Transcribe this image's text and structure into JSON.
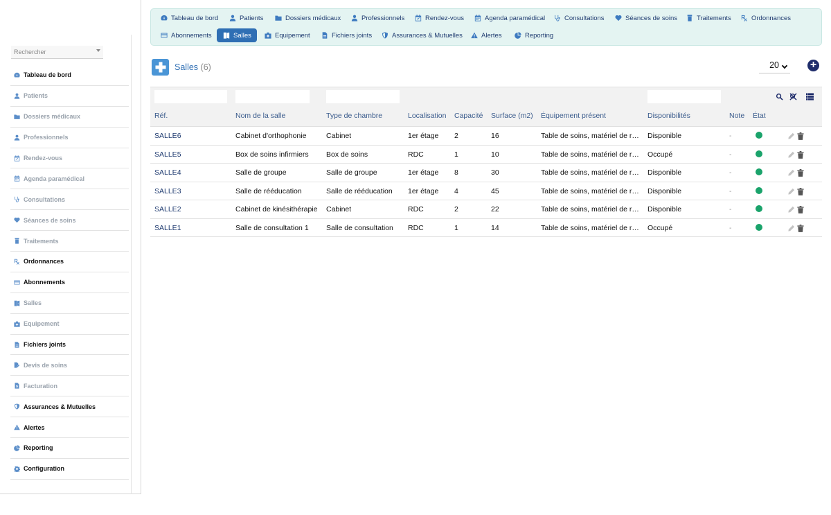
{
  "sidebar": {
    "search_placeholder": "Rechercher",
    "items": [
      {
        "label": "Tableau de bord",
        "icon": "dashboard-icon",
        "dark": true
      },
      {
        "label": "Patients",
        "icon": "user-icon",
        "dark": false
      },
      {
        "label": "Dossiers médicaux",
        "icon": "folder-icon",
        "dark": false
      },
      {
        "label": "Professionnels",
        "icon": "user-icon",
        "dark": false
      },
      {
        "label": "Rendez-vous",
        "icon": "calendar-check-icon",
        "dark": false
      },
      {
        "label": "Agenda paramédical",
        "icon": "calendar-icon",
        "dark": false
      },
      {
        "label": "Consultations",
        "icon": "stethoscope-icon",
        "dark": false
      },
      {
        "label": "Séances de soins",
        "icon": "heart-icon",
        "dark": false
      },
      {
        "label": "Traitements",
        "icon": "prescription-bottle-icon",
        "dark": false
      },
      {
        "label": "Ordonnances",
        "icon": "prescription-icon",
        "dark": true
      },
      {
        "label": "Abonnements",
        "icon": "card-icon",
        "dark": true
      },
      {
        "label": "Salles",
        "icon": "door-icon",
        "dark": false
      },
      {
        "label": "Equipement",
        "icon": "medkit-icon",
        "dark": false
      },
      {
        "label": "Fichiers joints",
        "icon": "file-icon",
        "dark": true
      },
      {
        "label": "Devis de soins",
        "icon": "file-edit-icon",
        "dark": false
      },
      {
        "label": "Facturation",
        "icon": "invoice-icon",
        "dark": false
      },
      {
        "label": "Assurances & Mutuelles",
        "icon": "shield-icon",
        "dark": true
      },
      {
        "label": "Alertes",
        "icon": "warning-icon",
        "dark": true
      },
      {
        "label": "Reporting",
        "icon": "chart-pie-icon",
        "dark": true
      },
      {
        "label": "Configuration",
        "icon": "gear-icon",
        "dark": true
      }
    ]
  },
  "topnav": {
    "row1": [
      {
        "label": "Tableau de bord",
        "icon": "dashboard-icon"
      },
      {
        "label": "Patients",
        "icon": "user-icon"
      },
      {
        "label": "Dossiers médicaux",
        "icon": "folder-icon"
      },
      {
        "label": "Professionnels",
        "icon": "user-icon"
      },
      {
        "label": "Rendez-vous",
        "icon": "calendar-check-icon"
      },
      {
        "label": "Agenda paramédical",
        "icon": "calendar-icon"
      },
      {
        "label": "Consultations",
        "icon": "stethoscope-icon"
      },
      {
        "label": "Séances de soins",
        "icon": "heart-icon"
      },
      {
        "label": "Traitements",
        "icon": "prescription-bottle-icon"
      },
      {
        "label": "Ordonnances",
        "icon": "prescription-icon"
      }
    ],
    "row2": [
      {
        "label": "Abonnements",
        "icon": "card-icon"
      },
      {
        "label": "Salles",
        "icon": "door-icon",
        "active": true
      },
      {
        "label": "Equipement",
        "icon": "medkit-icon"
      },
      {
        "label": "Fichiers joints",
        "icon": "file-icon"
      },
      {
        "label": "Assurances & Mutuelles",
        "icon": "shield-icon"
      },
      {
        "label": "Alertes",
        "icon": "warning-icon"
      },
      {
        "label": "Reporting",
        "icon": "chart-pie-icon"
      }
    ]
  },
  "page": {
    "title": "Salles",
    "count": "(6)",
    "per_page": "20"
  },
  "table": {
    "columns": [
      "Réf.",
      "Nom de la salle",
      "Type de chambre",
      "Localisation",
      "Capacité",
      "Surface (m2)",
      "Équipement présent",
      "Disponibilités",
      "Note",
      "État"
    ],
    "rows": [
      {
        "ref": "SALLE6",
        "nom": "Cabinet d'orthophonie",
        "type": "Cabinet",
        "loc": "1er étage",
        "cap": "2",
        "surf": "16",
        "equip": "Table de soins, matériel de rééducation",
        "dispo": "Disponible",
        "note": "-"
      },
      {
        "ref": "SALLE5",
        "nom": "Box de soins infirmiers",
        "type": "Box de soins",
        "loc": "RDC",
        "cap": "1",
        "surf": "10",
        "equip": "Table de soins, matériel de rééducation",
        "dispo": "Occupé",
        "note": "-"
      },
      {
        "ref": "SALLE4",
        "nom": "Salle de groupe",
        "type": "Salle de groupe",
        "loc": "1er étage",
        "cap": "8",
        "surf": "30",
        "equip": "Table de soins, matériel de rééducation",
        "dispo": "Disponible",
        "note": "-"
      },
      {
        "ref": "SALLE3",
        "nom": "Salle de rééducation",
        "type": "Salle de rééducation",
        "loc": "1er étage",
        "cap": "4",
        "surf": "45",
        "equip": "Table de soins, matériel de rééducation",
        "dispo": "Disponible",
        "note": "-"
      },
      {
        "ref": "SALLE2",
        "nom": "Cabinet de kinésithérapie",
        "type": "Cabinet",
        "loc": "RDC",
        "cap": "2",
        "surf": "22",
        "equip": "Table de soins, matériel de rééducation",
        "dispo": "Disponible",
        "note": "-"
      },
      {
        "ref": "SALLE1",
        "nom": "Salle de consultation 1",
        "type": "Salle de consultation",
        "loc": "RDC",
        "cap": "1",
        "surf": "14",
        "equip": "Table de soins, matériel de rééducation",
        "dispo": "Occupé",
        "note": "-"
      }
    ]
  },
  "colors": {
    "accent": "#2f6fb4",
    "nav_bg": "#e4f4f2",
    "status_green": "#1aa36b",
    "dark_navy": "#1f2d6b"
  }
}
